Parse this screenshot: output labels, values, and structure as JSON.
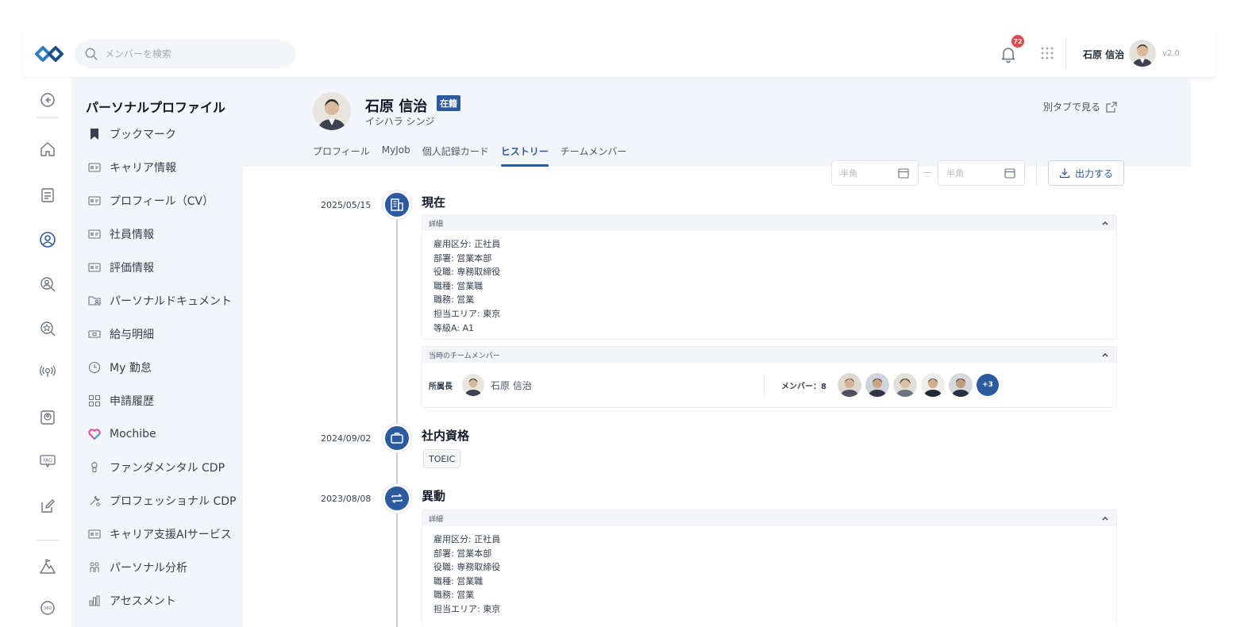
{
  "header": {
    "search_placeholder": "メンバーを検索",
    "notification_count": "72",
    "user_name": "石原 信治",
    "version": "v2.0"
  },
  "sidebar": {
    "title": "パーソナルプロファイル",
    "items": [
      {
        "label": "ブックマーク",
        "icon": "bookmark-icon"
      },
      {
        "label": "キャリア情報",
        "icon": "id-card-icon"
      },
      {
        "label": "プロフィール（CV）",
        "icon": "id-card-icon"
      },
      {
        "label": "社員情報",
        "icon": "id-card-icon"
      },
      {
        "label": "評価情報",
        "icon": "id-card-icon"
      },
      {
        "label": "パーソナルドキュメント",
        "icon": "folder-user-icon"
      },
      {
        "label": "給与明細",
        "icon": "payslip-icon"
      },
      {
        "label": "My 勤怠",
        "icon": "clock-icon"
      },
      {
        "label": "申請履歴",
        "icon": "application-grid-icon"
      },
      {
        "label": "Mochibe",
        "icon": "mochibe-heart-icon"
      },
      {
        "label": "ファンダメンタル CDP",
        "icon": "bulb-icon"
      },
      {
        "label": "プロフェッショナル CDP",
        "icon": "tools-icon"
      },
      {
        "label": "キャリア支援AIサービス",
        "icon": "id-card-icon"
      },
      {
        "label": "パーソナル分析",
        "icon": "people-analysis-icon"
      },
      {
        "label": "アセスメント",
        "icon": "assessment-icon"
      }
    ]
  },
  "profile": {
    "name": "石原 信治",
    "status": "在籍",
    "kana": "イシハラ シンジ",
    "open_new_tab": "別タブで見る",
    "tabs": [
      "プロフィール",
      "MyJob",
      "個人記録カード",
      "ヒストリー",
      "チームメンバー"
    ],
    "active_tab": "ヒストリー"
  },
  "filters": {
    "from_placeholder": "半角",
    "to_placeholder": "半角",
    "export_label": "出力する"
  },
  "timeline": [
    {
      "date": "2025/05/15",
      "title": "現在",
      "icon": "building-icon",
      "detail_heading": "詳細",
      "details": [
        "雇用区分: 正社員",
        "部署: 営業本部",
        "役職: 専務取締役",
        "職種: 営業職",
        "職務: 営業",
        "担当エリア: 東京",
        "等級A: A1"
      ],
      "team_heading": "当時のチームメンバー",
      "manager_label": "所属長",
      "manager_name": "石原 信治",
      "members_label": "メンバー：8",
      "more_count": "+3"
    },
    {
      "date": "2024/09/02",
      "title": "社内資格",
      "icon": "briefcase-icon",
      "tag": "TOEIC"
    },
    {
      "date": "2023/08/08",
      "title": "異動",
      "icon": "transfer-icon",
      "detail_heading": "詳細",
      "details": [
        "雇用区分: 正社員",
        "部署: 営業本部",
        "役職: 専務取締役",
        "職種: 営業職",
        "職務: 営業",
        "担当エリア: 東京"
      ]
    }
  ],
  "colors": {
    "accent": "#2b5b9e",
    "badge": "#e5484d",
    "sidebar_bg": "#f2f5f9"
  }
}
